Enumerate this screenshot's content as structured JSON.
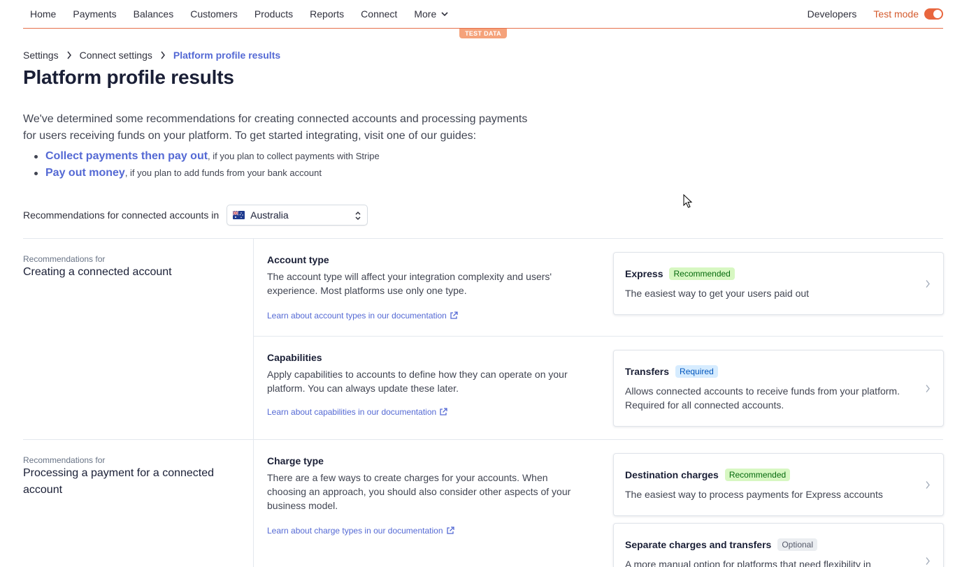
{
  "nav": {
    "items": [
      "Home",
      "Payments",
      "Balances",
      "Customers",
      "Products",
      "Reports",
      "Connect",
      "More"
    ],
    "developers": "Developers",
    "test_mode": "Test mode",
    "test_data_badge": "TEST DATA",
    "accent_color": "#e8663e"
  },
  "breadcrumb": [
    "Settings",
    "Connect settings",
    "Platform profile results"
  ],
  "page_title": "Platform profile results",
  "intro": {
    "text": "We've determined some recommendations for creating connected accounts and processing payments for users receiving funds on your platform. To get started integrating, visit one of our guides:",
    "guides": [
      {
        "link": "Collect payments then pay out",
        "suffix": ", if you plan to collect payments with Stripe"
      },
      {
        "link": "Pay out money",
        "suffix": ", if you plan to add funds from your bank account"
      }
    ]
  },
  "country": {
    "label": "Recommendations for connected accounts in",
    "selected": "Australia",
    "flag_icon": "australia-flag-icon"
  },
  "sections": [
    {
      "eyebrow": "Recommendations for",
      "title": "Creating a connected account",
      "blocks": [
        {
          "title": "Account type",
          "desc": "The account type will affect your integration complexity and users' experience. Most platforms use only one type.",
          "link": "Learn about account types in our documentation",
          "cards": [
            {
              "title": "Express",
              "badge": "Recommended",
              "badge_color": "green",
              "desc": "The easiest way to get your users paid out"
            }
          ]
        },
        {
          "title": "Capabilities",
          "desc": "Apply capabilities to accounts to define how they can operate on your platform. You can always update these later.",
          "link": "Learn about capabilities in our documentation",
          "cards": [
            {
              "title": "Transfers",
              "badge": "Required",
              "badge_color": "blue",
              "desc": "Allows connected accounts to receive funds from your platform. Required for all connected accounts."
            }
          ]
        }
      ]
    },
    {
      "eyebrow": "Recommendations for",
      "title": "Processing a payment for a connected account",
      "blocks": [
        {
          "title": "Charge type",
          "desc": "There are a few ways to create charges for your accounts. When choosing an approach, you should also consider other aspects of your business model.",
          "link": "Learn about charge types in our documentation",
          "cards": [
            {
              "title": "Destination charges",
              "badge": "Recommended",
              "badge_color": "green",
              "desc": "The easiest way to process payments for Express accounts"
            },
            {
              "title": "Separate charges and transfers",
              "badge": "Optional",
              "badge_color": "grey",
              "desc": "A more manual option for platforms that need flexibility in"
            }
          ]
        }
      ]
    }
  ]
}
